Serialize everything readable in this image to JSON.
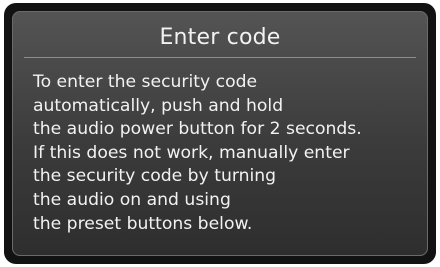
{
  "dialog": {
    "title": "Enter code",
    "message": "To enter the security code\nautomatically, push and hold\nthe audio power button for 2 seconds.\nIf this does not work, manually enter\nthe security code by turning\nthe audio on and using\nthe preset buttons below."
  }
}
